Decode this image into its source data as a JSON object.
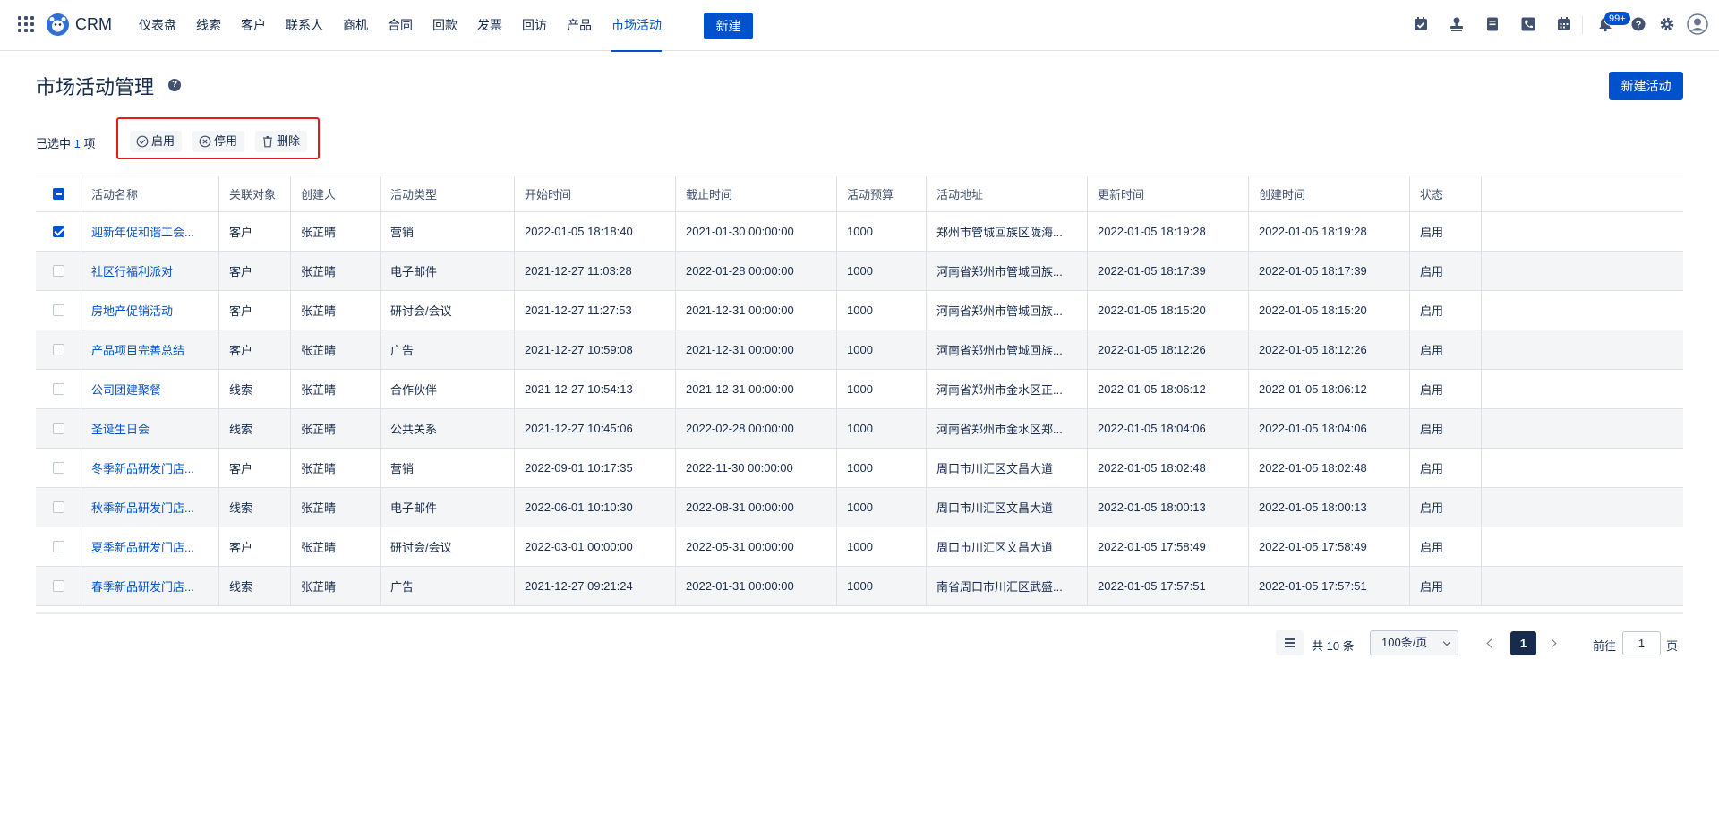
{
  "app": {
    "name": "CRM"
  },
  "nav": {
    "items": [
      "仪表盘",
      "线索",
      "客户",
      "联系人",
      "商机",
      "合同",
      "回款",
      "发票",
      "回访",
      "产品",
      "市场活动"
    ],
    "active": "市场活动",
    "new_label": "新建",
    "notification_badge": "99+"
  },
  "page": {
    "title": "市场活动管理",
    "help": "?",
    "new_activity_label": "新建活动"
  },
  "selection": {
    "prefix": "已选中",
    "count": "1",
    "suffix": "项",
    "actions": {
      "enable": "启用",
      "disable": "停用",
      "delete": "删除"
    }
  },
  "table": {
    "columns": [
      "活动名称",
      "关联对象",
      "创建人",
      "活动类型",
      "开始时间",
      "截止时间",
      "活动预算",
      "活动地址",
      "更新时间",
      "创建时间",
      "状态"
    ],
    "rows": [
      {
        "checked": true,
        "name": "迎新年促和谐工会...",
        "related": "客户",
        "creator": "张芷晴",
        "type": "营销",
        "start": "2022-01-05 18:18:40",
        "end": "2021-01-30 00:00:00",
        "budget": "1000",
        "address": "郑州市管城回族区陇海...",
        "updated": "2022-01-05 18:19:28",
        "created": "2022-01-05 18:19:28",
        "status": "启用"
      },
      {
        "checked": false,
        "name": "社区行福利派对",
        "related": "客户",
        "creator": "张芷晴",
        "type": "电子邮件",
        "start": "2021-12-27 11:03:28",
        "end": "2022-01-28 00:00:00",
        "budget": "1000",
        "address": "河南省郑州市管城回族...",
        "updated": "2022-01-05 18:17:39",
        "created": "2022-01-05 18:17:39",
        "status": "启用"
      },
      {
        "checked": false,
        "name": "房地产促销活动",
        "related": "客户",
        "creator": "张芷晴",
        "type": "研讨会/会议",
        "start": "2021-12-27 11:27:53",
        "end": "2021-12-31 00:00:00",
        "budget": "1000",
        "address": "河南省郑州市管城回族...",
        "updated": "2022-01-05 18:15:20",
        "created": "2022-01-05 18:15:20",
        "status": "启用"
      },
      {
        "checked": false,
        "name": "产品项目完善总结",
        "related": "客户",
        "creator": "张芷晴",
        "type": "广告",
        "start": "2021-12-27 10:59:08",
        "end": "2021-12-31 00:00:00",
        "budget": "1000",
        "address": "河南省郑州市管城回族...",
        "updated": "2022-01-05 18:12:26",
        "created": "2022-01-05 18:12:26",
        "status": "启用"
      },
      {
        "checked": false,
        "name": "公司团建聚餐",
        "related": "线索",
        "creator": "张芷晴",
        "type": "合作伙伴",
        "start": "2021-12-27 10:54:13",
        "end": "2021-12-31 00:00:00",
        "budget": "1000",
        "address": "河南省郑州市金水区正...",
        "updated": "2022-01-05 18:06:12",
        "created": "2022-01-05 18:06:12",
        "status": "启用"
      },
      {
        "checked": false,
        "name": "圣诞生日会",
        "related": "线索",
        "creator": "张芷晴",
        "type": "公共关系",
        "start": "2021-12-27 10:45:06",
        "end": "2022-02-28 00:00:00",
        "budget": "1000",
        "address": "河南省郑州市金水区郑...",
        "updated": "2022-01-05 18:04:06",
        "created": "2022-01-05 18:04:06",
        "status": "启用"
      },
      {
        "checked": false,
        "name": "冬季新品研发门店...",
        "related": "客户",
        "creator": "张芷晴",
        "type": "营销",
        "start": "2022-09-01 10:17:35",
        "end": "2022-11-30 00:00:00",
        "budget": "1000",
        "address": "周口市川汇区文昌大道",
        "updated": "2022-01-05 18:02:48",
        "created": "2022-01-05 18:02:48",
        "status": "启用"
      },
      {
        "checked": false,
        "name": "秋季新品研发门店...",
        "related": "线索",
        "creator": "张芷晴",
        "type": "电子邮件",
        "start": "2022-06-01 10:10:30",
        "end": "2022-08-31 00:00:00",
        "budget": "1000",
        "address": "周口市川汇区文昌大道",
        "updated": "2022-01-05 18:00:13",
        "created": "2022-01-05 18:00:13",
        "status": "启用"
      },
      {
        "checked": false,
        "name": "夏季新品研发门店...",
        "related": "客户",
        "creator": "张芷晴",
        "type": "研讨会/会议",
        "start": "2022-03-01 00:00:00",
        "end": "2022-05-31 00:00:00",
        "budget": "1000",
        "address": "周口市川汇区文昌大道",
        "updated": "2022-01-05 17:58:49",
        "created": "2022-01-05 17:58:49",
        "status": "启用"
      },
      {
        "checked": false,
        "name": "春季新品研发门店...",
        "related": "线索",
        "creator": "张芷晴",
        "type": "广告",
        "start": "2021-12-27 09:21:24",
        "end": "2022-01-31 00:00:00",
        "budget": "1000",
        "address": "南省周口市川汇区武盛...",
        "updated": "2022-01-05 17:57:51",
        "created": "2022-01-05 17:57:51",
        "status": "启用"
      }
    ]
  },
  "pagination": {
    "total_label": "共 10 条",
    "page_size": "100条/页",
    "current_page": "1",
    "goto_label": "前往",
    "goto_value": "1",
    "page_suffix": "页"
  },
  "colors": {
    "primary": "#0052cc",
    "text": "#172b4d",
    "highlight_border": "#e81919",
    "stripe": "#f4f5f7"
  }
}
